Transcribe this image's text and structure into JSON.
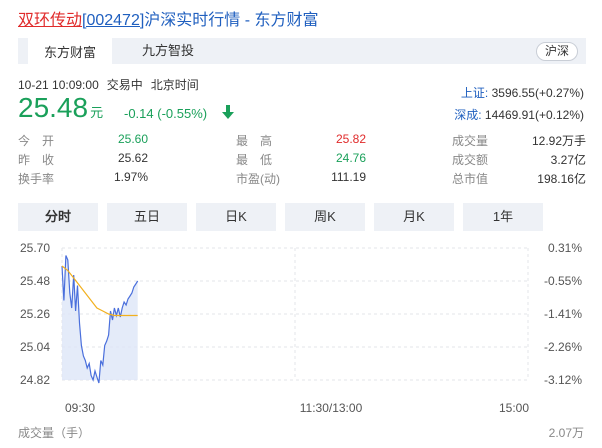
{
  "header": {
    "stock_name": "双环传动",
    "stock_code": "[002472]",
    "title_rest": "沪深实时行情 - 东方财富"
  },
  "tabs": [
    {
      "label": "东方财富",
      "active": true
    },
    {
      "label": "九方智投",
      "active": false
    }
  ],
  "market_button": "沪深",
  "status": {
    "datetime": "10-21 10:09:00",
    "state": "交易中",
    "timezone": "北京时间"
  },
  "quote": {
    "price": "25.48",
    "unit": "元",
    "change": "-0.14 (-0.55%)",
    "direction": "down",
    "color": "#1aa05a"
  },
  "indices": [
    {
      "label": "上证:",
      "value": "3596.55(+0.27%)"
    },
    {
      "label": "深成:",
      "value": "14469.91(+0.12%)"
    }
  ],
  "stats": [
    [
      {
        "label": "今　开",
        "value": "25.60",
        "tone": "green"
      },
      {
        "label": "最　高",
        "value": "25.82",
        "tone": "red"
      },
      {
        "label": "成交量",
        "value": "12.92万手",
        "tone": "dark"
      }
    ],
    [
      {
        "label": "昨　收",
        "value": "25.62",
        "tone": "dark"
      },
      {
        "label": "最　低",
        "value": "24.76",
        "tone": "green"
      },
      {
        "label": "成交额",
        "value": "3.27亿",
        "tone": "dark"
      }
    ],
    [
      {
        "label": "换手率",
        "value": "1.97%",
        "tone": "dark"
      },
      {
        "label": "市盈(动)",
        "value": "111.19",
        "tone": "dark"
      },
      {
        "label": "总市值",
        "value": "198.16亿",
        "tone": "dark"
      }
    ]
  ],
  "periods": [
    {
      "label": "分时",
      "active": true
    },
    {
      "label": "五日",
      "active": false
    },
    {
      "label": "日K",
      "active": false
    },
    {
      "label": "周K",
      "active": false
    },
    {
      "label": "月K",
      "active": false
    },
    {
      "label": "1年",
      "active": false
    }
  ],
  "volume_label": "成交量（手）",
  "volume_max": "2.07万",
  "chart_data": {
    "type": "line",
    "y_ticks_left": [
      "25.70",
      "25.48",
      "25.26",
      "25.04",
      "24.82"
    ],
    "y_ticks_right": [
      "0.31%",
      "-0.55%",
      "-1.41%",
      "-2.26%",
      "-3.12%"
    ],
    "x_ticks": [
      "09:30",
      "11:30/13:00",
      "15:00"
    ],
    "ylim": [
      24.82,
      25.7
    ],
    "x_total_minutes": 240,
    "colors": {
      "price": "#4a6fdc",
      "average": "#f2b01e",
      "fill": "#dde6f8"
    },
    "series": [
      {
        "key": "price",
        "x": [
          0,
          1,
          2,
          3,
          4,
          5,
          6,
          7,
          8,
          9,
          10,
          11,
          12,
          13,
          14,
          15,
          16,
          17,
          18,
          19,
          20,
          21,
          22,
          23,
          24,
          25,
          26,
          27,
          28,
          29,
          30,
          31,
          32,
          33,
          34,
          35,
          36,
          37,
          38,
          39
        ],
        "y": [
          25.58,
          25.35,
          25.65,
          25.62,
          25.4,
          25.3,
          25.52,
          25.28,
          25.45,
          25.2,
          25.05,
          24.98,
          24.95,
          24.9,
          24.93,
          24.85,
          24.82,
          24.88,
          24.84,
          24.8,
          24.95,
          24.92,
          25.05,
          25.08,
          25.12,
          25.28,
          25.22,
          25.3,
          25.25,
          25.3,
          25.24,
          25.3,
          25.34,
          25.32,
          25.36,
          25.38,
          25.4,
          25.44,
          25.46,
          25.48
        ]
      },
      {
        "key": "average",
        "x": [
          0,
          3,
          6,
          9,
          12,
          15,
          18,
          21,
          24,
          27,
          30,
          33,
          36,
          39
        ],
        "y": [
          25.58,
          25.55,
          25.5,
          25.45,
          25.4,
          25.35,
          25.3,
          25.28,
          25.26,
          25.25,
          25.25,
          25.25,
          25.25,
          25.25
        ]
      }
    ]
  }
}
